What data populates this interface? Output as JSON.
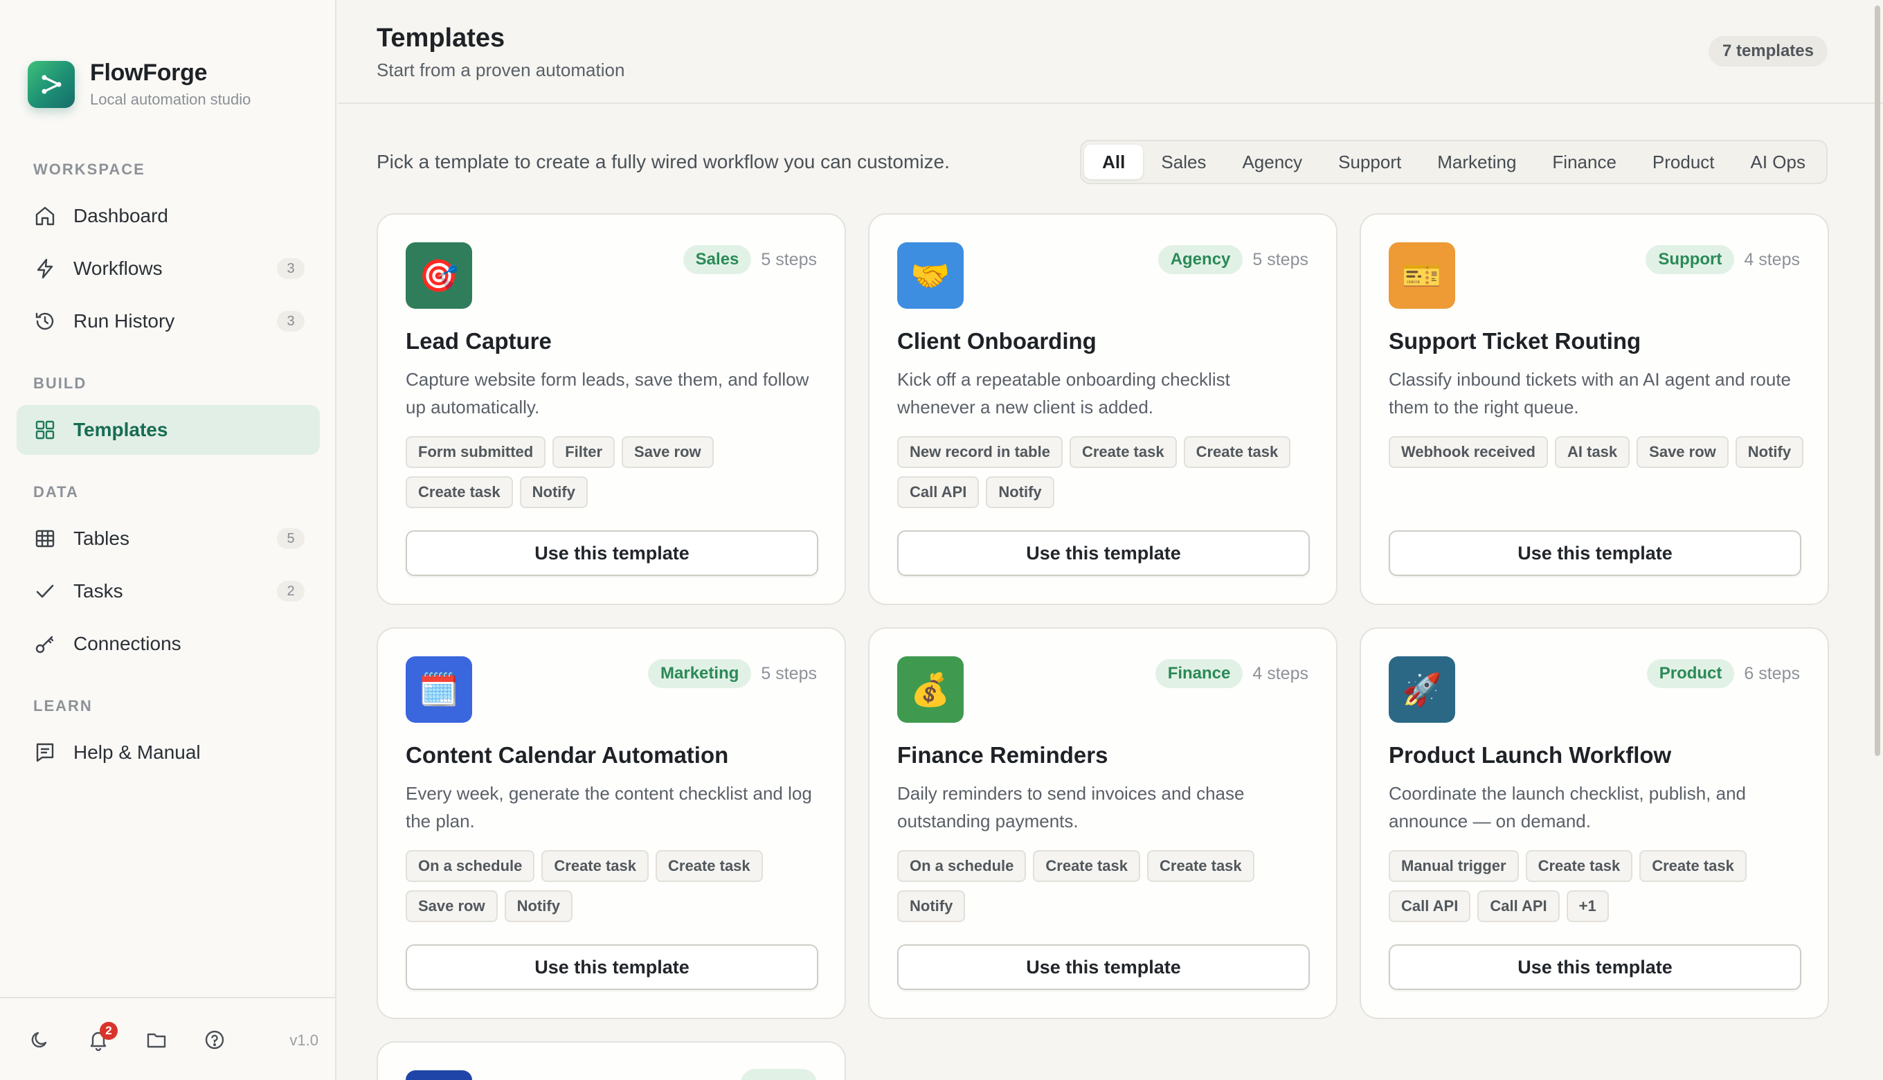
{
  "brand": {
    "name": "FlowForge",
    "subtitle": "Local automation studio"
  },
  "sidebar": {
    "sections": {
      "workspace": "WORKSPACE",
      "build": "BUILD",
      "data": "DATA",
      "learn": "LEARN"
    },
    "items": [
      {
        "label": "Dashboard",
        "icon": "home-icon"
      },
      {
        "label": "Workflows",
        "icon": "bolt-icon",
        "count": "3"
      },
      {
        "label": "Run History",
        "icon": "history-icon",
        "count": "3"
      },
      {
        "label": "Templates",
        "icon": "grid-icon",
        "active": true
      },
      {
        "label": "Tables",
        "icon": "table-icon",
        "count": "5"
      },
      {
        "label": "Tasks",
        "icon": "check-icon",
        "count": "2"
      },
      {
        "label": "Connections",
        "icon": "key-icon"
      },
      {
        "label": "Help & Manual",
        "icon": "book-icon"
      }
    ],
    "footer": {
      "notifications": "2",
      "version": "v1.0"
    }
  },
  "header": {
    "title": "Templates",
    "subtitle": "Start from a proven automation",
    "count": "7 templates"
  },
  "intro": "Pick a template to create a fully wired workflow you can customize.",
  "filters": [
    "All",
    "Sales",
    "Agency",
    "Support",
    "Marketing",
    "Finance",
    "Product",
    "AI Ops"
  ],
  "cards": [
    {
      "title": "Lead Capture",
      "category": "Sales",
      "steps": "5 steps",
      "icon": "target-icon",
      "glyph": "🎯",
      "color": "#2f7d5b",
      "desc": "Capture website form leads, save them, and follow up automatically.",
      "chips": [
        "Form submitted",
        "Filter",
        "Save row",
        "Create task",
        "Notify"
      ],
      "button": "Use this template"
    },
    {
      "title": "Client Onboarding",
      "category": "Agency",
      "steps": "5 steps",
      "icon": "handshake-icon",
      "glyph": "🤝",
      "color": "#3d8de0",
      "desc": "Kick off a repeatable onboarding checklist whenever a new client is added.",
      "chips": [
        "New record in table",
        "Create task",
        "Create task",
        "Call API",
        "Notify"
      ],
      "button": "Use this template"
    },
    {
      "title": "Support Ticket Routing",
      "category": "Support",
      "steps": "4 steps",
      "icon": "ticket-icon",
      "glyph": "🎫",
      "color": "#ee9a35",
      "desc": "Classify inbound tickets with an AI agent and route them to the right queue.",
      "chips": [
        "Webhook received",
        "AI task",
        "Save row",
        "Notify"
      ],
      "button": "Use this template"
    },
    {
      "title": "Content Calendar Automation",
      "category": "Marketing",
      "steps": "5 steps",
      "icon": "calendar-icon",
      "glyph": "🗓️",
      "color": "#3a66de",
      "desc": "Every week, generate the content checklist and log the plan.",
      "chips": [
        "On a schedule",
        "Create task",
        "Create task",
        "Save row",
        "Notify"
      ],
      "button": "Use this template"
    },
    {
      "title": "Finance Reminders",
      "category": "Finance",
      "steps": "4 steps",
      "icon": "money-bag-icon",
      "glyph": "💰",
      "color": "#3f9a4f",
      "desc": "Daily reminders to send invoices and chase outstanding payments.",
      "chips": [
        "On a schedule",
        "Create task",
        "Create task",
        "Notify"
      ],
      "button": "Use this template"
    },
    {
      "title": "Product Launch Workflow",
      "category": "Product",
      "steps": "6 steps",
      "icon": "rocket-icon",
      "glyph": "🚀",
      "color": "#2b6886",
      "desc": "Coordinate the launch checklist, publish, and announce — on demand.",
      "chips": [
        "Manual trigger",
        "Create task",
        "Create task",
        "Call API",
        "Call API",
        "+1"
      ],
      "button": "Use this template"
    }
  ]
}
